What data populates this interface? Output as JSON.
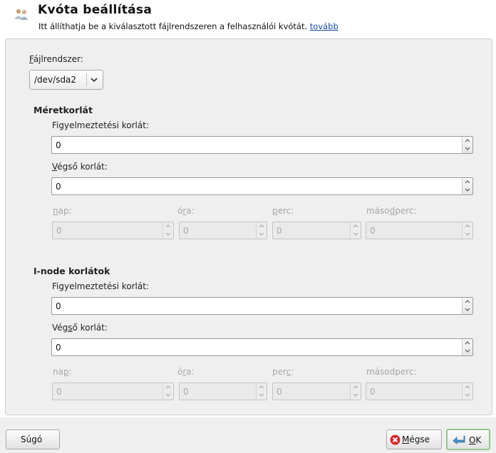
{
  "header": {
    "icon": "users-quota-icon",
    "title": "Kvóta beállítása",
    "subtitle": "Itt állíthatja be a kiválasztott fájlrendszeren a felhasználói kvótát.",
    "more_link": "tovább"
  },
  "filesystem": {
    "label_u": "F",
    "label_rest": "ájlrendszer:",
    "selected": "/dev/sda2"
  },
  "size_limits": {
    "title": "Méretkorlát",
    "warning_label": "Figyelmeztetési korlát:",
    "warning_value": "0",
    "hard_label_u": "V",
    "hard_label_rest": "égső korlát:",
    "hard_value": "0",
    "grace": {
      "days_u": "n",
      "days_rest": "ap:",
      "days_value": "0",
      "hours_pre": "ó",
      "hours_u": "r",
      "hours_rest": "a:",
      "hours_value": "0",
      "minutes_u": "p",
      "minutes_rest": "erc:",
      "minutes_value": "0",
      "seconds_pre": "máso",
      "seconds_u": "d",
      "seconds_rest": "perc:",
      "seconds_value": "0"
    }
  },
  "inode_limits": {
    "title": "I-node korlátok",
    "warning_label": "Figyelmeztetési korlát:",
    "warning_value": "0",
    "hard_label_pre": "Vég",
    "hard_label_u": "s",
    "hard_label_rest": "ő korlát:",
    "hard_value": "0",
    "grace": {
      "days_pre": "na",
      "days_u": "p",
      "days_rest": ":",
      "days_value": "0",
      "hours_pre": "ó",
      "hours_u": "r",
      "hours_rest": "a:",
      "hours_value": "0",
      "minutes_pre": "per",
      "minutes_u": "c",
      "minutes_rest": ":",
      "minutes_value": "0",
      "seconds_label": "másodperc:",
      "seconds_value": "0"
    }
  },
  "buttons": {
    "help": "Súgó",
    "cancel_u": "M",
    "cancel_rest": "égse",
    "ok_u": "O",
    "ok_rest": "K"
  },
  "colors": {
    "panel_bg": "#efefef",
    "link": "#1b4aa8",
    "disabled_text": "#a6a6a6",
    "cancel_icon": "#d8262a",
    "ok_icon": "#4d8fc7"
  }
}
